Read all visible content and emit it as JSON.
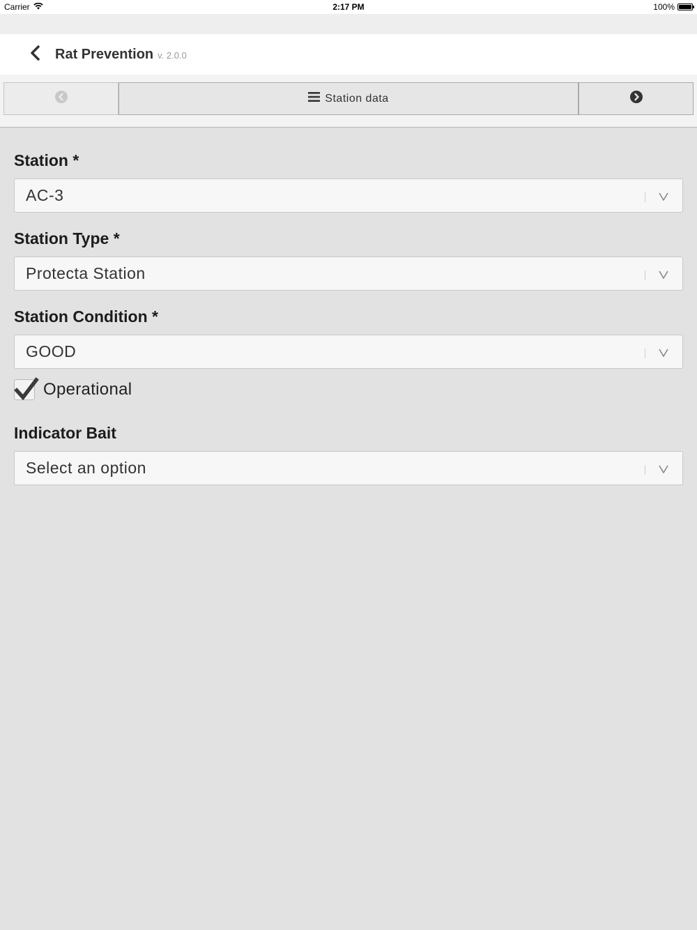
{
  "status_bar": {
    "carrier": "Carrier",
    "time": "2:17 PM",
    "battery": "100%"
  },
  "header": {
    "title": "Rat Prevention",
    "version": "v. 2.0.0"
  },
  "nav": {
    "center_label": "Station data"
  },
  "form": {
    "station": {
      "label": "Station *",
      "value": "AC-3"
    },
    "station_type": {
      "label": "Station Type *",
      "value": "Protecta Station"
    },
    "station_condition": {
      "label": "Station Condition *",
      "value": "GOOD"
    },
    "operational": {
      "label": "Operational",
      "checked": true
    },
    "indicator_bait": {
      "label": "Indicator Bait",
      "placeholder": "Select an option"
    }
  },
  "colors": {
    "background": "#e2e2e2",
    "header_bg": "#ffffff",
    "text": "#222222",
    "icon_dark": "#333333",
    "icon_disabled": "#c8c8c8"
  }
}
